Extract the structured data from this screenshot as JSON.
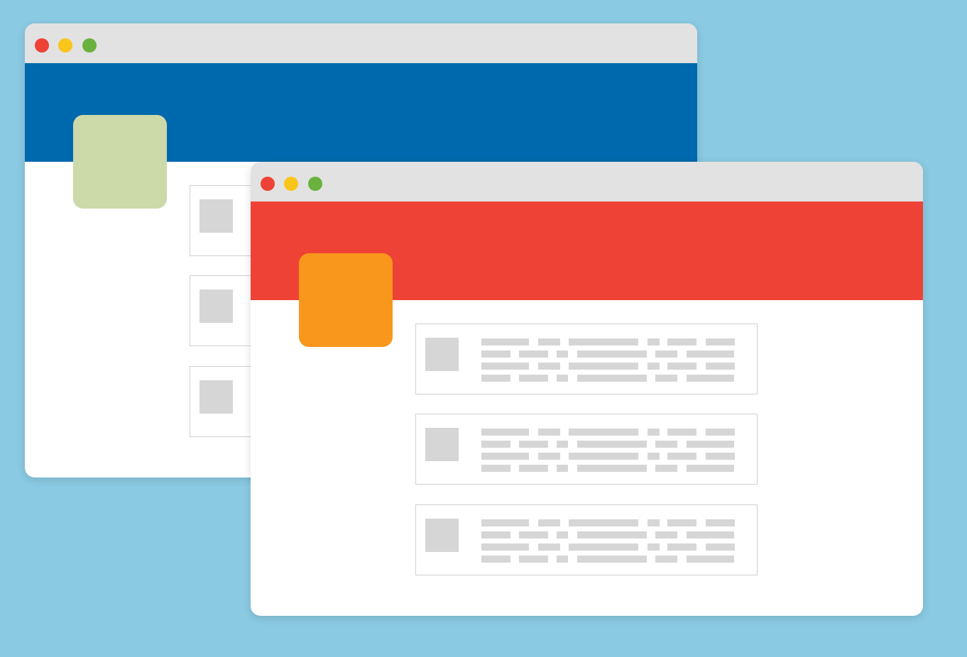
{
  "colors": {
    "background": "#8acae2",
    "titlebar": "#e2e2e2",
    "dot_close": "#ee4236",
    "dot_minimize": "#f9c51b",
    "dot_maximize": "#6ab13e",
    "placeholder": "#d6d6d6"
  },
  "windows": [
    {
      "id": "window-back",
      "banner_color": "#0069ad",
      "logo_color": "#ccd9a9",
      "card_count": 3
    },
    {
      "id": "window-front",
      "banner_color": "#ef4236",
      "logo_color": "#f9971d",
      "card_count": 3
    }
  ],
  "icons": {
    "close": "close-dot-icon",
    "minimize": "minimize-dot-icon",
    "maximize": "maximize-dot-icon",
    "thumbnail": "image-placeholder-icon"
  }
}
